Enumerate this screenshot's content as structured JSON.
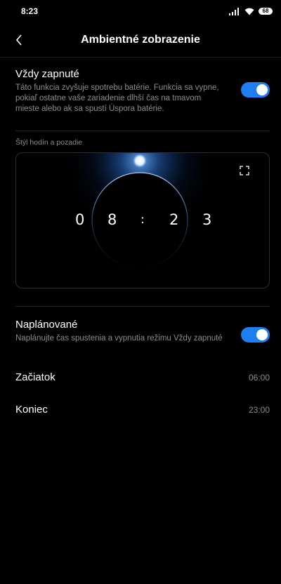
{
  "status_bar": {
    "time": "8:23",
    "battery": "68",
    "icons": [
      "signal-icon",
      "wifi-icon",
      "battery-icon"
    ]
  },
  "header": {
    "back_icon": "chevron-left-icon",
    "title": "Ambientné zobrazenie"
  },
  "always_on": {
    "title": "Vždy zapnuté",
    "description": "Táto funkcia zvyšuje spotrebu batérie. Funkcia sa vypne, pokiaľ ostatne vaše zariadenie dlhší čas na tmavom mieste alebo ak sa spustí Úspora batérie.",
    "enabled": true
  },
  "clock_style": {
    "section_label": "Štýl hodín a pozadie",
    "digits": [
      "0",
      "8",
      ":",
      "2",
      "3"
    ],
    "fullscreen_icon": "fullscreen-icon"
  },
  "scheduled": {
    "title": "Naplánované",
    "description": "Naplánujte čas spustenia a vypnutia režimu Vždy zapnuté",
    "enabled": true
  },
  "start": {
    "label": "Začiatok",
    "value": "06:00"
  },
  "end": {
    "label": "Koniec",
    "value": "23:00"
  },
  "colors": {
    "accent": "#1f7ef0",
    "background": "#000000",
    "secondary_text": "#8c8c8c"
  }
}
